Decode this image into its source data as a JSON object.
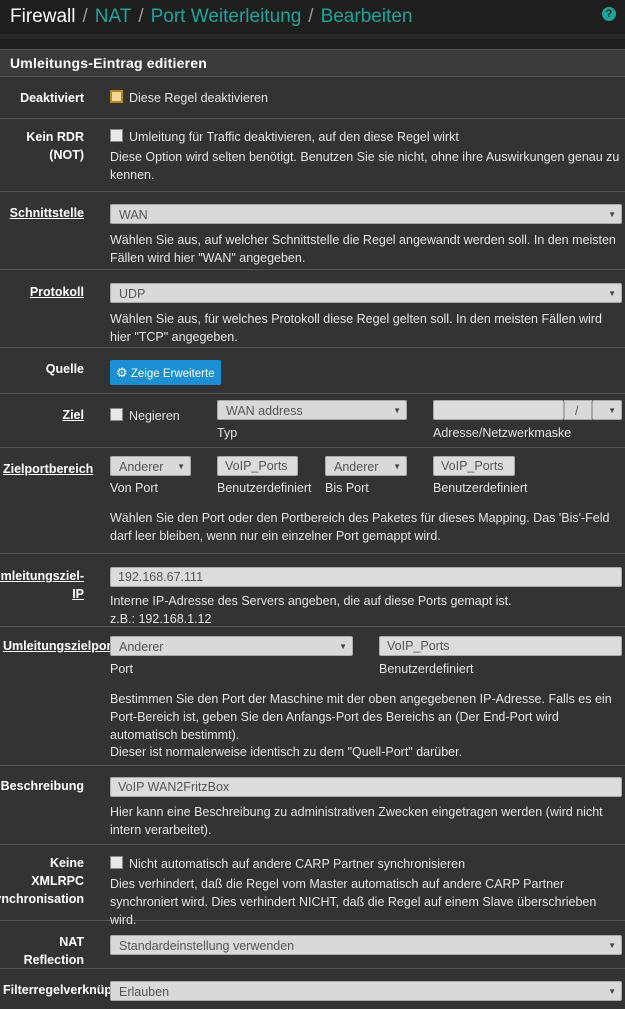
{
  "breadcrumb": [
    "Firewall",
    "NAT",
    "Port Weiterleitung",
    "Bearbeiten"
  ],
  "panel_title": "Umleitungs-Eintrag editieren",
  "disabled": {
    "label": "Deaktiviert",
    "checkbox": "Diese Regel deaktivieren"
  },
  "nordr": {
    "label1": "Kein RDR",
    "label2": "(NOT)",
    "checkbox": "Umleitung für Traffic deaktivieren, auf den diese Regel wirkt",
    "help": "Diese Option wird selten benötigt. Benutzen Sie sie nicht, ohne ihre Auswirkungen genau zu kennen."
  },
  "interface": {
    "label": "Schnittstelle",
    "value": "WAN",
    "help": "Wählen Sie aus, auf welcher Schnittstelle die Regel angewandt werden soll. In den meisten Fällen wird hier \"WAN\" angegeben."
  },
  "protocol": {
    "label": "Protokoll",
    "value": "UDP",
    "help": "Wählen Sie aus, für welches Protokoll diese Regel gelten soll. In den meisten Fällen wird hier \"TCP\" angegeben."
  },
  "source": {
    "label": "Quelle",
    "button": "Zeige Erweiterte"
  },
  "destination": {
    "label": "Ziel",
    "invert": "Negieren",
    "type_value": "WAN address",
    "type_label": "Typ",
    "slash": "/",
    "addr_label": "Adresse/Netzwerkmaske"
  },
  "dstport": {
    "label": "Zielportbereich",
    "from_value": "Anderer",
    "from_custom": "VoIP_Ports",
    "to_value": "Anderer",
    "to_custom": "VoIP_Ports",
    "from_label": "Von Port",
    "custom_label1": "Benutzerdefiniert",
    "to_label": "Bis Port",
    "custom_label2": "Benutzerdefiniert",
    "help": "Wählen Sie den Port oder den Portbereich des Paketes für dieses Mapping. Das 'Bis'-Feld darf leer bleiben, wenn nur ein einzelner Port gemappt wird."
  },
  "targetip": {
    "label1": "Umleitungsziel-",
    "label2": "IP",
    "value": "192.168.67.111",
    "help1": "Interne IP-Adresse des Servers angeben, die auf diese Ports gemapt ist.",
    "help2": "z.B.: 192.168.1.12"
  },
  "targetport": {
    "label": "Umleitungszielport",
    "value": "Anderer",
    "custom": "VoIP_Ports",
    "port_label": "Port",
    "custom_label": "Benutzerdefiniert",
    "help1": "Bestimmen Sie den Port der Maschine mit der oben angegebenen IP-Adresse. Falls es ein Port-Bereich ist, geben Sie den Anfangs-Port des Bereichs an (Der End-Port wird automatisch bestimmt).",
    "help2": "Dieser ist normalerweise identisch zu dem \"Quell-Port\" darüber."
  },
  "descr": {
    "label": "Beschreibung",
    "value": "VoIP WAN2FritzBox",
    "help": "Hier kann eine Beschreibung zu administrativen Zwecken eingetragen werden (wird nicht intern verarbeitet)."
  },
  "nosync": {
    "label1": "Keine",
    "label2": "XMLRPC",
    "label3": "Synchronisation",
    "checkbox": "Nicht automatisch auf andere CARP Partner synchronisieren",
    "help": "Dies verhindert, daß die Regel vom Master automatisch auf andere CARP Partner synchroniert wird. Dies verhindert NICHT, daß die Regel auf einem Slave überschrieben wird."
  },
  "natreflection": {
    "label1": "NAT",
    "label2": "Reflection",
    "value": "Standardeinstellung verwenden"
  },
  "filterrule": {
    "label": "Filterregelverknüpfung",
    "value": "Erlauben"
  },
  "colors": {
    "accent": "#1aa59a",
    "button": "#1b8fd1"
  }
}
